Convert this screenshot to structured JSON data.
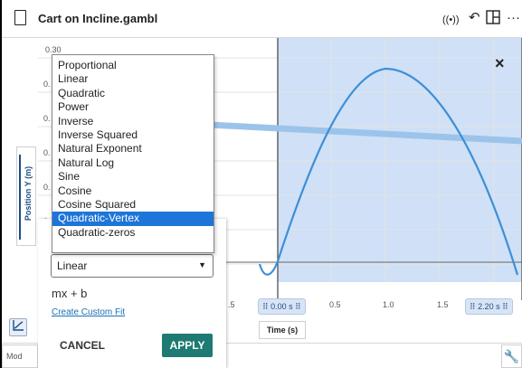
{
  "titlebar": {
    "filename": "Cart on Incline.gambl",
    "icons": [
      "broadcast-icon",
      "undo-icon",
      "layout-icon",
      "more-icon"
    ]
  },
  "graph": {
    "y_axis_label": "Position Y (m)",
    "y_tick_top": "0.30",
    "y_tick_partials": [
      "0.",
      "0.",
      "0.",
      "0.",
      "0."
    ],
    "x_axis_label": "Time (s)",
    "x_ticks": [
      ".5",
      "0.5",
      "1.0",
      "1.5"
    ],
    "range_start": "0.00 s",
    "range_end": "2.20 s",
    "close_label": "×",
    "colors": {
      "selection": "#cfe0f7",
      "curve": "#3d8fd6",
      "data_band": "#9cc4ea"
    }
  },
  "fit_dropdown": {
    "options": [
      "Proportional",
      "Linear",
      "Quadratic",
      "Power",
      "Inverse",
      "Inverse Squared",
      "Natural Exponent",
      "Natural Log",
      "Sine",
      "Cosine",
      "Cosine Squared",
      "Quadratic-Vertex",
      "Quadratic-zeros"
    ],
    "highlighted": "Quadratic-Vertex"
  },
  "fit_panel": {
    "selected": "Linear",
    "formula": "mx + b",
    "custom_link": "Create Custom Fit",
    "cancel": "CANCEL",
    "apply": "APPLY",
    "accent": "#1e7a72"
  },
  "bottom": {
    "tab_label": "Mod"
  }
}
